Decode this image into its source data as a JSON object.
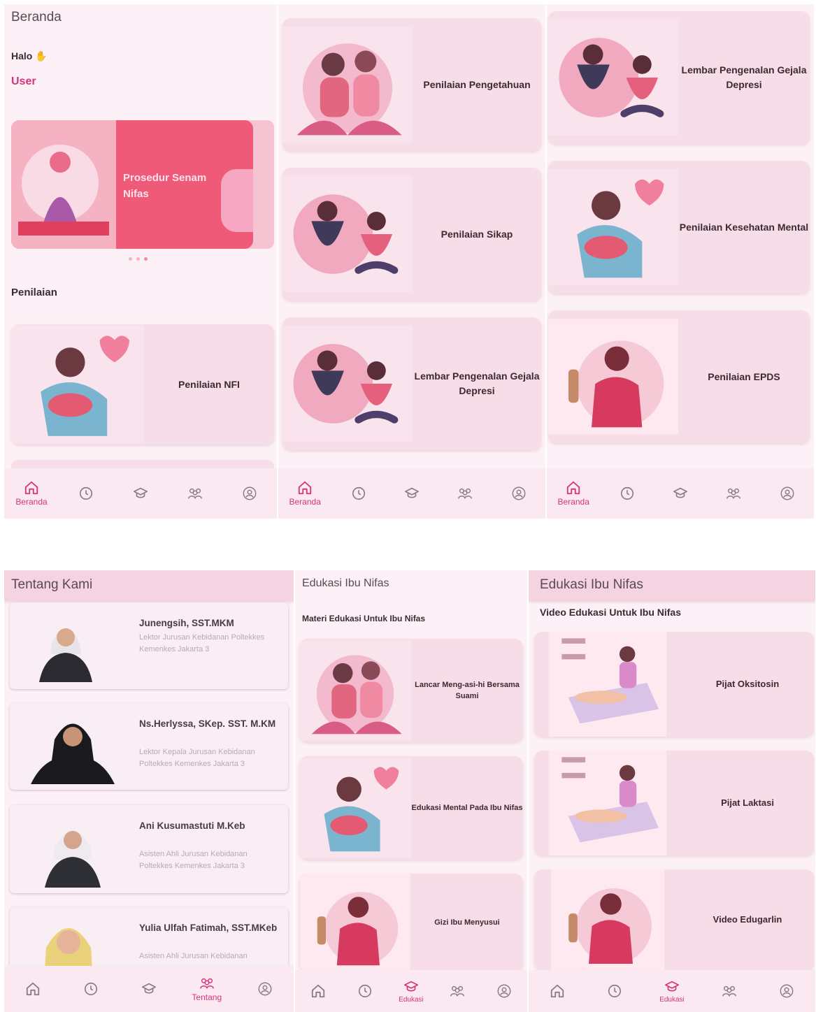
{
  "p1": {
    "title": "Beranda",
    "greeting": "Halo",
    "user": "User",
    "banner": "Prosedur Senam Nifas",
    "section": "Penilaian",
    "card": "Penilaian NFI",
    "nav_label": "Beranda"
  },
  "p2": {
    "cards": [
      "Penilaian Pengetahuan",
      "Penilaian Sikap",
      "Lembar Pengenalan Gejala Depresi"
    ],
    "nav_label": "Beranda"
  },
  "p3": {
    "cards": [
      "Lembar Pengenalan Gejala Depresi",
      "Penilaian Kesehatan Mental",
      "Penilaian EPDS"
    ],
    "nav_label": "Beranda"
  },
  "p4": {
    "title": "Tentang Kami",
    "people": [
      {
        "name": "Junengsih, SST.MKM",
        "desc": "Lektor Jurusan Kebidanan Poltekkes Kemenkes Jakarta 3"
      },
      {
        "name": "Ns.Herlyssa, SKep. SST. M.KM",
        "desc": "Lektor Kepala Jurusan Kebidanan Poltekkes Kemenkes Jakarta 3"
      },
      {
        "name": "Ani Kusumastuti M.Keb",
        "desc": "Asisten Ahli Jurusan Kebidanan Poltekkes Kemenkes Jakarta 3"
      },
      {
        "name": "Yulia Ulfah Fatimah, SST.MKeb",
        "desc": "Asisten Ahli Jurusan Kebidanan"
      }
    ],
    "nav_label": "Tentang"
  },
  "p5": {
    "title": "Edukasi Ibu Nifas",
    "subtitle": "Materi Edukasi Untuk Ibu Nifas",
    "cards": [
      "Lancar Meng-asi-hi Bersama Suami",
      "Edukasi Mental Pada Ibu Nifas",
      "Gizi Ibu Menyusui"
    ],
    "nav_label": "Edukasi"
  },
  "p6": {
    "title": "Edukasi Ibu Nifas",
    "subtitle": "Video Edukasi Untuk Ibu Nifas",
    "cards": [
      "Pijat Oksitosin",
      "Pijat Laktasi",
      "Video Edugarlin"
    ],
    "nav_label": "Edukasi"
  },
  "colors": {
    "accent": "#d6337a",
    "card": "#f7dde7",
    "banner": "#ef5a79"
  },
  "nav_icons": [
    "home-icon",
    "history-icon",
    "graduation-cap-icon",
    "team-icon",
    "profile-icon"
  ]
}
